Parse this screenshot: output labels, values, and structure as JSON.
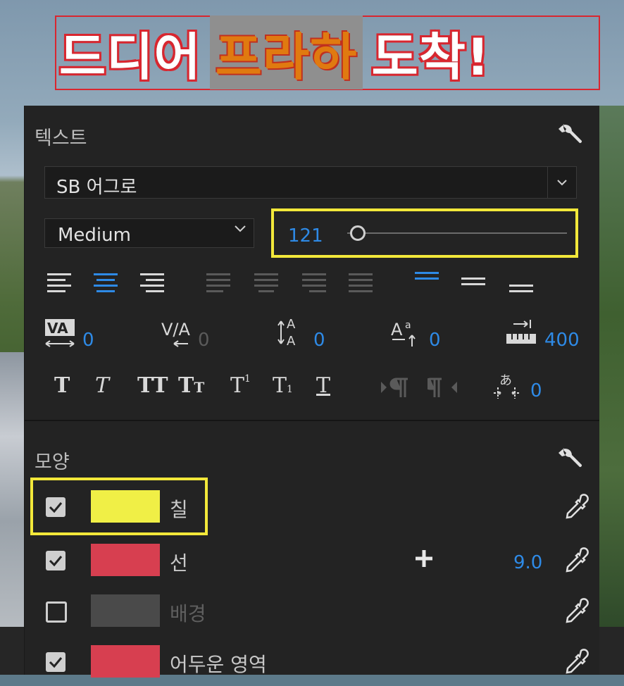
{
  "title": {
    "part1": "드디어",
    "highlight": "프라하",
    "part2": "도착!"
  },
  "text_section": {
    "title": "텍스트",
    "font_family": "SB 어그로",
    "font_style": "Medium",
    "font_size": "121",
    "kerning": "0",
    "tracking": "0",
    "leading": "0",
    "baseline_shift": "0",
    "tab_width": "400",
    "tsume": "0"
  },
  "appearance_section": {
    "title": "모양",
    "rows": [
      {
        "label": "칠",
        "checked": true,
        "color": "#f0ef46"
      },
      {
        "label": "선",
        "checked": true,
        "color": "#d73f50",
        "value": "9.0"
      },
      {
        "label": "배경",
        "checked": false,
        "color": "#4a4a4a"
      },
      {
        "label": "어두운 영역",
        "checked": true,
        "color": "#d73f50"
      }
    ]
  },
  "colors": {
    "accent": "#2e8ae6",
    "highlight_box": "#f2e83a",
    "panel": "#232323"
  }
}
